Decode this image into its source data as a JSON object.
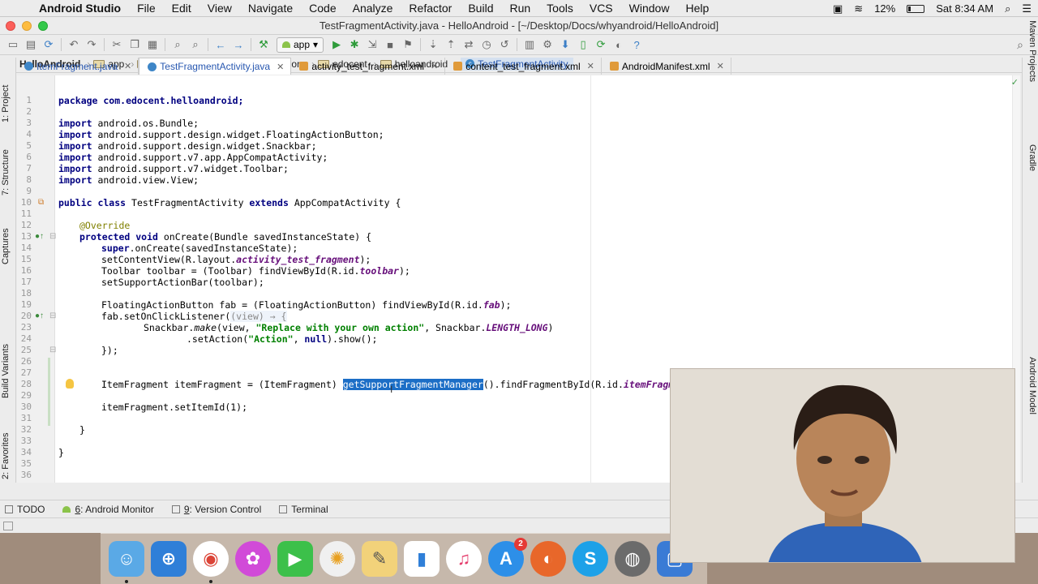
{
  "menubar": {
    "app_name": "Android Studio",
    "items": [
      "File",
      "Edit",
      "View",
      "Navigate",
      "Code",
      "Analyze",
      "Refactor",
      "Build",
      "Run",
      "Tools",
      "VCS",
      "Window",
      "Help"
    ],
    "battery": "12%",
    "clock": "Sat 8:34 AM"
  },
  "window": {
    "title": "TestFragmentActivity.java - HelloAndroid - [~/Desktop/Docs/whyandroid/HelloAndroid]"
  },
  "toolbar": {
    "run_config": "app"
  },
  "breadcrumb": [
    "HelloAndroid",
    "app",
    "src",
    "main",
    "java",
    "com",
    "edocent",
    "helloandroid",
    "TestFragmentActivity"
  ],
  "tabs": [
    {
      "label": "ItemFragment.java",
      "type": "java"
    },
    {
      "label": "TestFragmentActivity.java",
      "type": "java"
    },
    {
      "label": "activity_test_fragment.xml",
      "type": "xml"
    },
    {
      "label": "content_test_fragment.xml",
      "type": "xml"
    },
    {
      "label": "AndroidManifest.xml",
      "type": "xml"
    }
  ],
  "left_tools": [
    "1: Project",
    "7: Structure",
    "Captures",
    "Build Variants",
    "2: Favorites"
  ],
  "right_tools": [
    "Maven Projects",
    "Gradle",
    "Android Model"
  ],
  "bottom_tools": [
    {
      "label": "TODO"
    },
    {
      "mnemonic": "6",
      "label": ": Android Monitor"
    },
    {
      "mnemonic": "9",
      "label": ": Version Control"
    },
    {
      "label": "Terminal"
    }
  ],
  "editor": {
    "line_numbers": [
      "1",
      "2",
      "3",
      "4",
      "5",
      "6",
      "7",
      "8",
      "9",
      "10",
      "11",
      "12",
      "13",
      "14",
      "15",
      "16",
      "17",
      "18",
      "19",
      "20",
      "23",
      "24",
      "25",
      "26",
      "27",
      "28",
      "29",
      "30",
      "31",
      "32",
      "33",
      "34",
      "35",
      "36"
    ],
    "line1": "package com.edocent.helloandroid;",
    "imp_kw": "import",
    "imports": [
      " android.os.Bundle;",
      " android.support.design.widget.FloatingActionButton;",
      " android.support.design.widget.Snackbar;",
      " android.support.v7.app.AppCompatActivity;",
      " android.support.v7.widget.Toolbar;",
      " android.view.View;"
    ],
    "cls_kw1": "public class",
    "cls_name": " TestFragmentActivity ",
    "cls_kw2": "extends",
    "cls_rest": " AppCompatActivity {",
    "override": "@Override",
    "oncreate_kw": "protected void",
    "oncreate_rest": " onCreate(Bundle savedInstanceState) {",
    "super_kw": "super",
    "super_rest": ".onCreate(savedInstanceState);",
    "setcv_a": "setContentView(R.layout.",
    "setcv_f": "activity_test_fragment",
    "setcv_b": ");",
    "toolbar_a": "Toolbar toolbar = (Toolbar) findViewById(R.id.",
    "toolbar_f": "toolbar",
    "toolbar_b": ");",
    "setsab": "setSupportActionBar(toolbar);",
    "fab_a": "FloatingActionButton fab = (FloatingActionButton) findViewById(R.id.",
    "fab_f": "fab",
    "fab_b": ");",
    "listener_a": "fab.setOnClickListener(",
    "listener_lambda": "(view) → {",
    "snack_a": "Snackbar.",
    "snack_make": "make",
    "snack_b": "(view, ",
    "snack_str": "\"Replace with your own action\"",
    "snack_c": ", Snackbar.",
    "snack_f": "LENGTH_LONG",
    "snack_d": ")",
    "setaction_a": ".setAction(",
    "setaction_str": "\"Action\"",
    "setaction_b": ", ",
    "setaction_kw": "null",
    "setaction_c": ").show();",
    "close_lambda": "});",
    "item_a": "ItemFragment itemFragment = (ItemFragment) ",
    "item_sel": "getSupportFragmentManager",
    "item_b": "().findFragmentById(R.id.",
    "item_f": "itemFragmentId",
    "setitem": "itemFragment.setItemId(1);",
    "close_method": "}",
    "close_class": "}"
  }
}
